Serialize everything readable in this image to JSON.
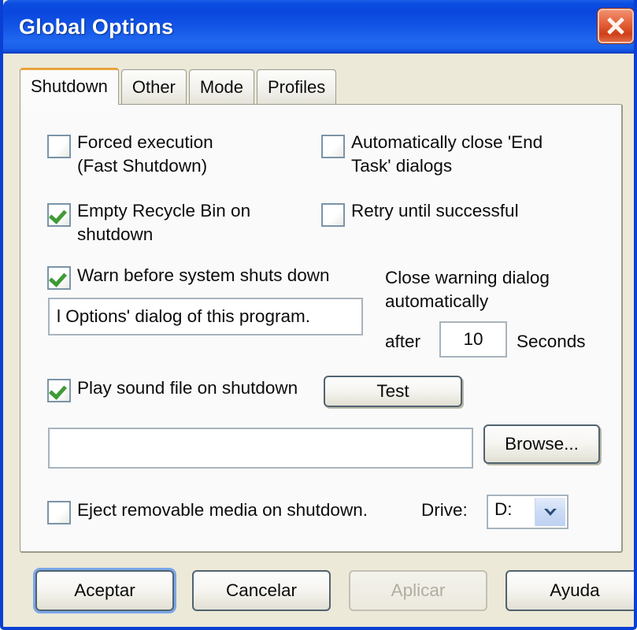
{
  "window": {
    "title": "Global Options",
    "close_icon": "close-x-icon",
    "accent_title_bar": "#0b4ee0",
    "accent_close_button": "#cf3f18",
    "accent_active_tab": "#e8a33d",
    "accent_check": "#3f9b36",
    "dialog_background": "#ece9d8"
  },
  "tabs": [
    {
      "label": "Shutdown",
      "active": true
    },
    {
      "label": "Other",
      "active": false
    },
    {
      "label": "Mode",
      "active": false
    },
    {
      "label": "Profiles",
      "active": false
    }
  ],
  "shutdown_tab": {
    "forced_execution": {
      "label": "Forced execution\n(Fast Shutdown)",
      "checked": false
    },
    "auto_close_end_task": {
      "label": "Automatically close 'End\nTask' dialogs",
      "checked": false
    },
    "empty_recycle_bin": {
      "label": "Empty Recycle Bin on\nshutdown",
      "checked": true
    },
    "retry_until_successful": {
      "label": "Retry until successful",
      "checked": false
    },
    "warn_before_shutdown": {
      "label": "Warn before system shuts down",
      "checked": true
    },
    "warn_message": {
      "value": "l Options' dialog of this program.",
      "placeholder": ""
    },
    "close_warning": {
      "label": "Close warning dialog\nautomatically",
      "after_label": "after",
      "seconds_value": "10",
      "seconds_label": "Seconds"
    },
    "play_sound": {
      "label": "Play sound file on shutdown",
      "checked": true
    },
    "test_button": "Test",
    "sound_file": {
      "value": "",
      "placeholder": ""
    },
    "browse_button": "Browse...",
    "eject_media": {
      "label": "Eject removable media on shutdown.",
      "checked": false
    },
    "drive_label": "Drive:",
    "drive_select": {
      "value": "D:",
      "options": [
        "D:"
      ],
      "arrow_icon": "chevron-down-icon"
    }
  },
  "footer": {
    "ok": "Aceptar",
    "cancel": "Cancelar",
    "apply": "Aplicar",
    "apply_disabled": true,
    "help": "Ayuda"
  }
}
